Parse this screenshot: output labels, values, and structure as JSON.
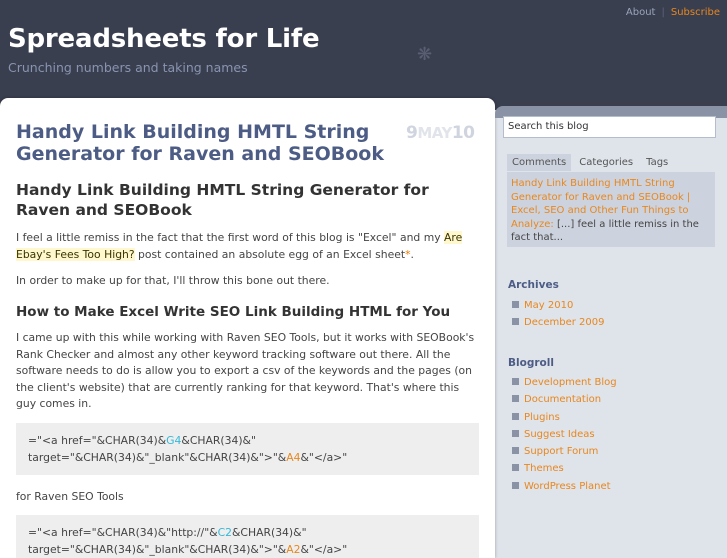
{
  "header": {
    "nav": [
      "About",
      "Subscribe"
    ],
    "site_title": "Spreadsheets for Life",
    "site_desc": "Crunching numbers and taking names"
  },
  "post": {
    "title": "Handy Link Building HMTL String Generator for Raven and SEOBook",
    "date_day": "9",
    "date_month": "MAY",
    "date_year": "10",
    "heading": "Handy Link Building HMTL String Generator for Raven and SEOBook",
    "p1_a": "I feel a little remiss in the fact that the first word of this blog is \"Excel\" and my ",
    "p1_link": "Are Ebay's Fees Too High?",
    "p1_b": " post contained an absolute egg of an Excel sheet",
    "p1_star": "*",
    "p1_end": ".",
    "p2": "In order to make up for that, I'll throw this bone out there.",
    "h3": "How to Make Excel Write SEO Link Building HTML for You",
    "p3": "I came up with this while working with Raven SEO Tools, but it works with SEOBook's Rank Checker and almost any other keyword tracking software out there. All the software needs to do is allow you to export a csv of the keywords and the pages (on the client's website) that are currently ranking for that keyword. That's where this guy comes in.",
    "code1": {
      "a": "=\"<a href=\"&CHAR(34)&",
      "cell1": "G4",
      "b": "&CHAR(34)&\" target=\"&CHAR(34)&\"_blank\"&CHAR(34)&\">\"&",
      "cell2": "A4",
      "c": "&\"</a>\""
    },
    "p4": "for Raven SEO Tools",
    "code2": {
      "a": "=\"<a href=\"&CHAR(34)&\"http://\"&",
      "cell1": "C2",
      "b": "&CHAR(34)&\" target=\"&CHAR(34)&\"_blank\"&CHAR(34)&\">\"&",
      "cell2": "A2",
      "c": "&\"</a>\""
    }
  },
  "sidebar": {
    "search_placeholder": "Search this blog",
    "tabs": [
      "Comments",
      "Categories",
      "Tags"
    ],
    "comment_link": "Handy Link Building HMTL String Generator for Raven and SEOBook | Excel, SEO and Other Fun Things to Analyze:",
    "comment_text": " [...] feel a little remiss in the fact that...",
    "archives_heading": "Archives",
    "archives": [
      "May 2010",
      "December 2009"
    ],
    "blogroll_heading": "Blogroll",
    "blogroll": [
      "Development Blog",
      "Documentation",
      "Plugins",
      "Suggest Ideas",
      "Support Forum",
      "Themes",
      "WordPress Planet"
    ]
  }
}
